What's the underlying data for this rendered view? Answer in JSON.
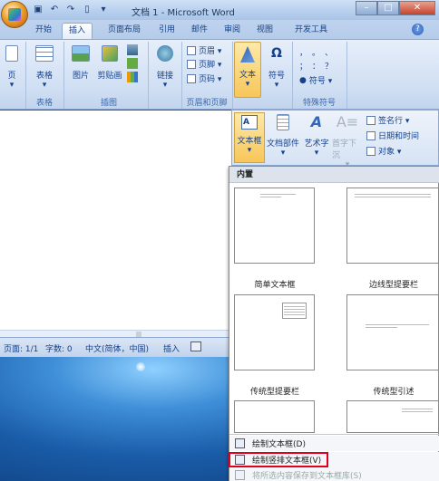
{
  "window": {
    "title": "文档 1 - Microsoft Word",
    "min_label": "–",
    "max_label": "□",
    "close_label": "✕",
    "help_label": "?"
  },
  "quick_access": {
    "save_icon": "save-icon",
    "undo_icon": "undo-icon",
    "redo_icon": "redo-icon",
    "customize_icon": "customize-icon"
  },
  "tabs": [
    "开始",
    "插入",
    "页面布局",
    "引用",
    "邮件",
    "审阅",
    "视图",
    "开发工具"
  ],
  "active_tab": "插入",
  "ribbon": {
    "pages_group": {
      "button": "页"
    },
    "tables_group": {
      "label": "表格",
      "button": "表格"
    },
    "illustrations_group": {
      "label": "插图",
      "picture": "图片",
      "clipart": "剪贴画"
    },
    "links_group": {
      "button": "链接"
    },
    "header_footer_group": {
      "label": "页眉和页脚",
      "header": "页眉 ▾",
      "footer": "页脚 ▾",
      "page_number": "页码 ▾"
    },
    "text_group": {
      "button": "文本"
    },
    "symbols_group": {
      "button": "符号",
      "label": "特殊符号",
      "symbol_item": "符号 ▾",
      "glyphs": [
        "，",
        "。",
        "、",
        "；",
        "：",
        "？"
      ]
    }
  },
  "text_panel": {
    "textbox": "文本框",
    "quickparts": "文档部件",
    "wordart": "艺术字",
    "dropcap": "首字下沉",
    "signature": "签名行 ▾",
    "datetime": "日期和时间",
    "object": "对象 ▾"
  },
  "gallery": {
    "section_title": "内置",
    "thumbnails": [
      {
        "caption": "简单文本框"
      },
      {
        "caption": "边线型提要栏"
      },
      {
        "caption": "传统型提要栏"
      },
      {
        "caption": "传统型引述"
      }
    ],
    "menu": [
      {
        "label": "绘制文本框(D)"
      },
      {
        "label": "绘制竖排文本框(V)"
      },
      {
        "label": "将所选内容保存到文本框库(S)"
      }
    ]
  },
  "status_bar": {
    "page": "页面: 1/1",
    "words": "字数: 0",
    "language": "中文(简体，中国)",
    "insert_mode": "插入"
  },
  "colors": {
    "highlight": "#e0001a",
    "ribbon_text": "#15428b"
  }
}
